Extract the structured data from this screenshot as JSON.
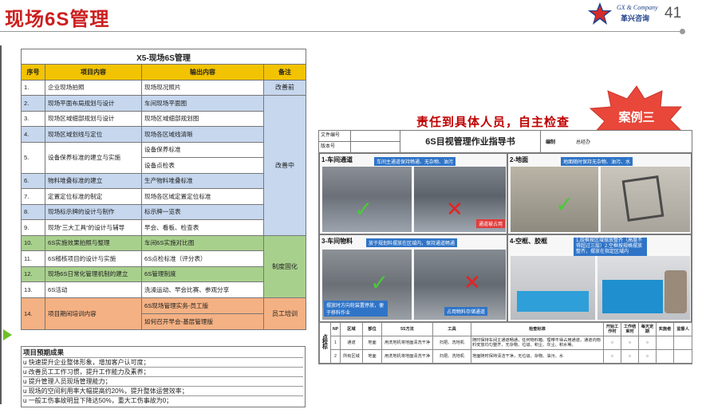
{
  "header": {
    "title": "现场6S管理",
    "logo_en": "GX & Company",
    "logo_cn": "革兴咨询",
    "page_number": "41"
  },
  "plan_table": {
    "caption": "X5-现场6S管理",
    "columns": [
      "序号",
      "项目内容",
      "输出内容",
      "备注"
    ],
    "rows": [
      {
        "no": "1.",
        "item": "企业现场拍照",
        "output": [
          "现场现况照片"
        ],
        "remark": "改善前"
      },
      {
        "no": "2.",
        "item": "现场平面布局规划与设计",
        "output": [
          "车间现场平面图"
        ],
        "remark": ""
      },
      {
        "no": "3.",
        "item": "现场区域细部规划与设计",
        "output": [
          "现场区域细部规划图"
        ],
        "remark": ""
      },
      {
        "no": "4.",
        "item": "现场区域划线与定位",
        "output": [
          "现场各区域线清晰"
        ],
        "remark": ""
      },
      {
        "no": "5.",
        "item": "设备保养标准的建立与实施",
        "output": [
          "设备保养标准",
          "设备点检表"
        ],
        "remark": "改善中"
      },
      {
        "no": "6.",
        "item": "物料堆叠标准的建立",
        "output": [
          "生产物料堆叠标准"
        ],
        "remark": ""
      },
      {
        "no": "7.",
        "item": "定置定位标准的制定",
        "output": [
          "现场各区域定置定位标准"
        ],
        "remark": ""
      },
      {
        "no": "8.",
        "item": "现场标示牌的设计与制作",
        "output": [
          "标示牌一览表"
        ],
        "remark": ""
      },
      {
        "no": "9.",
        "item": "现场“三大工具”的设计与辅导",
        "output": [
          "早会、看板、检查表"
        ],
        "remark": ""
      },
      {
        "no": "10.",
        "item": "6S实施效果拍照与整理",
        "output": [
          "车间6S实施对比图"
        ],
        "remark": ""
      },
      {
        "no": "11.",
        "item": "6S稽核项目的设计与实施",
        "output": [
          "6S点检标准（评分表）"
        ],
        "remark": "制度固化"
      },
      {
        "no": "12.",
        "item": "现场6S日常化管理机制的建立",
        "output": [
          "6S管理制度"
        ],
        "remark": ""
      },
      {
        "no": "13.",
        "item": "6S活动",
        "output": [
          "洗澡运动、早会比赛、参观分享"
        ],
        "remark": ""
      },
      {
        "no": "14.",
        "item": "项目期间培训内容",
        "output": [
          "6S现场管理实务-员工版",
          "如何召开早会-基层管理版"
        ],
        "remark": "员工培训"
      }
    ]
  },
  "results": {
    "title": "项目预期成果",
    "bullet": "u",
    "items": [
      "快速提升企业整体形象，增加客户认可度；",
      "改善员工工作习惯，提升工作能力及素养；",
      "提升管理人员现场管理能力；",
      "现场的空间利用率大幅提高约20%，提升整体运营效率；",
      "一般工伤事故明显下降达50%，重大工伤事故为0；"
    ]
  },
  "right": {
    "heading": "责任到具体人员，自主检查",
    "case_badge": "案例三",
    "doc": {
      "file_no_label": "文件编号",
      "version_label": "版本号",
      "title": "6S目视管理作业指导书",
      "author_label": "编制",
      "author_value": "总经办",
      "panels": [
        {
          "label": "1-车间通道",
          "note": "车间主通道保持畅通、无杂物、油污",
          "tag": "通道被占用"
        },
        {
          "label": "2-地面",
          "note": "地面随时保持无杂物、油污、水",
          "tag": ""
        },
        {
          "label": "3-车间物料",
          "note": "放于规划料摆放在区域内，保持通道畅通",
          "tag": "摆放时方向轮装置停放，便于移料作业",
          "tag2": "占用物料存储通道"
        },
        {
          "label": "4-空框、胶框",
          "note": "1.胶框按区域摆放整齐（高度不得超过三层）2.空框按规格摆放整齐，摆放在指定区域内",
          "tag": ""
        }
      ],
      "table_head": [
        "NP",
        "区域",
        "部位",
        "5S方法",
        "工具",
        "检查标准",
        "开始工作时",
        "工作结束时",
        "每天定期",
        "实施者",
        "监督人"
      ],
      "side_label": "点检标",
      "table_rows": [
        {
          "np": "1",
          "area": "通道",
          "part": "地面",
          "method": "用洗地机将地面清洗干净",
          "tool": "扫把、洗地机",
          "standard": "随时保持车间主通道畅通，任何物料箱、理带不得占用通道，通道内物料安放均匀整齐，无杂物、垃圾、积尘、灰尘、积水等。",
          "c1": "○",
          "c2": "○",
          "c3": "○",
          "who": "",
          "sup": ""
        },
        {
          "np": "2",
          "area": "所有区域",
          "part": "地面",
          "method": "用洗地机将地面清洗干净",
          "tool": "扫把、洗地机",
          "standard": "地面随时保持清洁干净，无垃圾、杂物、油污、水",
          "c1": "○",
          "c2": "○",
          "c3": "○",
          "who": "",
          "sup": ""
        }
      ]
    }
  }
}
